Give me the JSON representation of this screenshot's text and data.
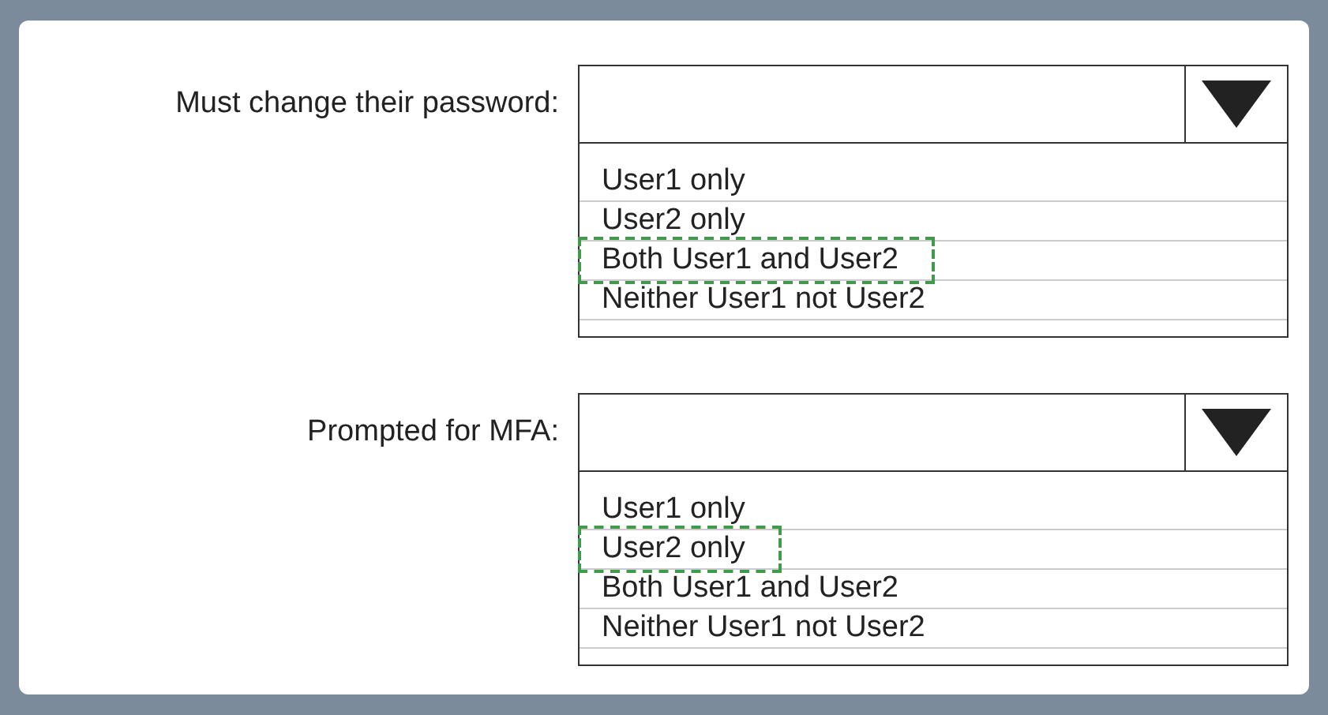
{
  "questions": [
    {
      "label": "Must change their password:",
      "options": [
        {
          "text": "User1 only",
          "selected": false
        },
        {
          "text": "User2 only",
          "selected": false
        },
        {
          "text": "Both User1 and User2",
          "selected": true
        },
        {
          "text": "Neither User1 not User2",
          "selected": false
        }
      ]
    },
    {
      "label": "Prompted for MFA:",
      "options": [
        {
          "text": "User1 only",
          "selected": false
        },
        {
          "text": "User2 only",
          "selected": true
        },
        {
          "text": "Both User1 and User2",
          "selected": false
        },
        {
          "text": "Neither User1 not User2",
          "selected": false
        }
      ]
    }
  ]
}
